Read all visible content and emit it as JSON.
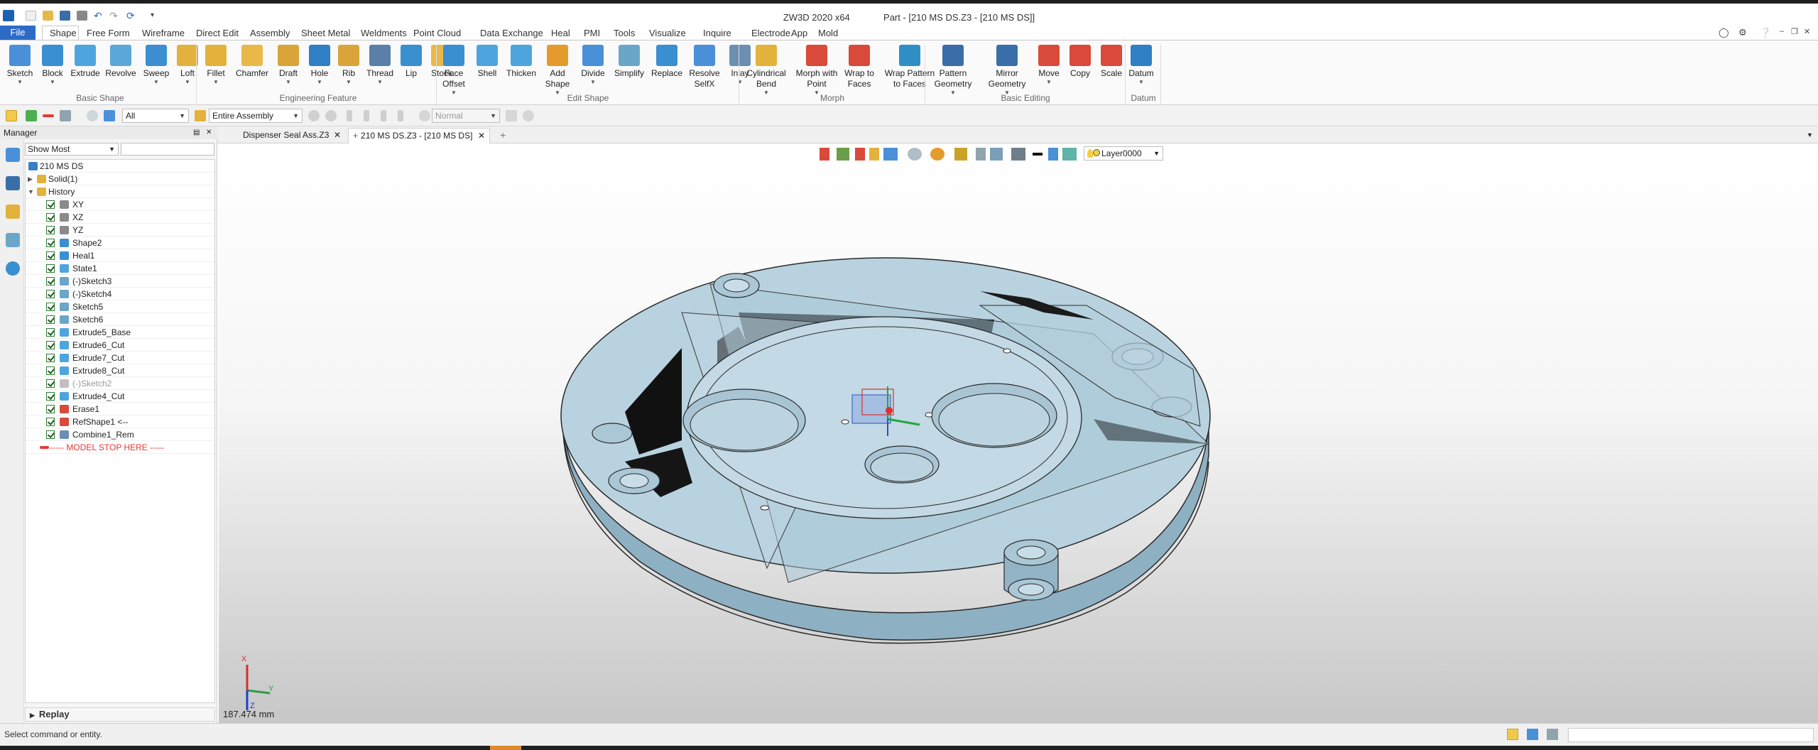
{
  "titlebar": {
    "app_title": "ZW3D 2020 x64",
    "doc_title": "Part - [210 MS DS.Z3 - [210 MS DS]]",
    "quick_access_icons": [
      "new-icon",
      "open-icon",
      "save-icon",
      "print-icon",
      "undo-icon",
      "redo-icon",
      "regen-icon",
      "customize-icon"
    ]
  },
  "menu": {
    "file": "File",
    "items": [
      "Shape",
      "Free Form",
      "Wireframe",
      "Direct Edit",
      "Assembly",
      "Sheet Metal",
      "Weldments",
      "Point Cloud",
      "Data Exchange",
      "Heal",
      "PMI",
      "Tools",
      "Visualize",
      "Inquire",
      "Electrode",
      "App",
      "Mold"
    ],
    "active": "Shape"
  },
  "ribbon": {
    "groups": [
      {
        "label": "Basic Shape",
        "buttons": [
          {
            "label": "Sketch",
            "color": "#4a90d9",
            "dropdown": true
          },
          {
            "label": "Block",
            "color": "#3a8fd0",
            "dropdown": true
          },
          {
            "label": "Extrude",
            "color": "#4ea5de",
            "dropdown": false
          },
          {
            "label": "Revolve",
            "color": "#5aa7d8",
            "dropdown": false
          },
          {
            "label": "Sweep",
            "color": "#3d8ed0",
            "dropdown": true
          },
          {
            "label": "Loft",
            "color": "#e3b23c",
            "dropdown": true
          }
        ]
      },
      {
        "label": "Engineering Feature",
        "buttons": [
          {
            "label": "Fillet",
            "color": "#e3b23c",
            "dropdown": true
          },
          {
            "label": "Chamfer",
            "color": "#e8b84a",
            "dropdown": false
          },
          {
            "label": "Draft",
            "color": "#d9a53a",
            "dropdown": true
          },
          {
            "label": "Hole",
            "color": "#2f7fc4",
            "dropdown": true
          },
          {
            "label": "Rib",
            "color": "#d9a53a",
            "dropdown": true
          },
          {
            "label": "Thread",
            "color": "#5a7fa8",
            "dropdown": true
          },
          {
            "label": "Lip",
            "color": "#3a8fd0",
            "dropdown": false
          },
          {
            "label": "Stock",
            "color": "#e8b84a",
            "dropdown": false
          }
        ]
      },
      {
        "label": "Edit Shape",
        "buttons": [
          {
            "label": "Face",
            "label2": "Offset",
            "color": "#3a8fd0",
            "dropdown": true
          },
          {
            "label": "Shell",
            "color": "#4ea5de",
            "dropdown": false
          },
          {
            "label": "Thicken",
            "color": "#4ea5de",
            "dropdown": false
          },
          {
            "label": "Add",
            "label2": "Shape",
            "color": "#e39b2c",
            "dropdown": true
          },
          {
            "label": "Divide",
            "color": "#4a90d9",
            "dropdown": true
          },
          {
            "label": "Simplify",
            "color": "#6aa6c8",
            "dropdown": false
          },
          {
            "label": "Replace",
            "color": "#3a8fd0",
            "dropdown": false
          },
          {
            "label": "Resolve",
            "label2": "SelfX",
            "color": "#4a90d9",
            "dropdown": false
          },
          {
            "label": "Inlay",
            "color": "#6a8fb0",
            "dropdown": true
          }
        ]
      },
      {
        "label": "Morph",
        "buttons": [
          {
            "label": "Cylindrical",
            "label2": "Bend",
            "color": "#e3b23c",
            "dropdown": true
          },
          {
            "label": "Morph with",
            "label2": "Point",
            "color": "#d94a3a",
            "dropdown": true
          },
          {
            "label": "Wrap to",
            "label2": "Faces",
            "color": "#d94a3a",
            "dropdown": false
          },
          {
            "label": "Wrap Pattern",
            "label2": "to Faces",
            "color": "#2f8fc4",
            "dropdown": false
          }
        ]
      },
      {
        "label": "Basic Editing",
        "buttons": [
          {
            "label": "Pattern",
            "label2": "Geometry",
            "color": "#3a6ea8",
            "dropdown": true
          },
          {
            "label": "Mirror",
            "label2": "Geometry",
            "color": "#3a6ea8",
            "dropdown": true
          },
          {
            "label": "Move",
            "color": "#d94a3a",
            "dropdown": true
          },
          {
            "label": "Copy",
            "color": "#d94a3a",
            "dropdown": false
          },
          {
            "label": "Scale",
            "color": "#d94a3a",
            "dropdown": false
          }
        ]
      },
      {
        "label": "Datum",
        "buttons": [
          {
            "label": "Datum",
            "color": "#2f7fc4",
            "dropdown": true
          }
        ]
      }
    ]
  },
  "toolbar2": {
    "filter_value": "All",
    "scope_value": "Entire Assembly",
    "mode_value": "Normal"
  },
  "manager": {
    "title": "Manager",
    "filter_value": "Show Most",
    "tree": [
      {
        "label": "210 MS DS",
        "level": 0,
        "checkbox": false,
        "icon_color": "#3a7fc4"
      },
      {
        "label": "Solid(1)",
        "level": 1,
        "checkbox": false,
        "expander": "+",
        "icon_color": "#e3b23c"
      },
      {
        "label": "History",
        "level": 1,
        "checkbox": false,
        "expander": "-",
        "icon_color": "#e3b23c"
      },
      {
        "label": "XY",
        "checkbox": true,
        "icon_color": "#8a8a8a"
      },
      {
        "label": "XZ",
        "checkbox": true,
        "icon_color": "#8a8a8a"
      },
      {
        "label": "YZ",
        "checkbox": true,
        "icon_color": "#8a8a8a"
      },
      {
        "label": "Shape2",
        "checkbox": true,
        "icon_color": "#3a8fd0"
      },
      {
        "label": "Heal1",
        "checkbox": true,
        "icon_color": "#3a8fd0"
      },
      {
        "label": "State1",
        "checkbox": true,
        "icon_color": "#4ea5de"
      },
      {
        "label": "(-)Sketch3",
        "checkbox": true,
        "icon_color": "#6aa6c8"
      },
      {
        "label": "(-)Sketch4",
        "checkbox": true,
        "icon_color": "#6aa6c8"
      },
      {
        "label": "Sketch5",
        "checkbox": true,
        "icon_color": "#6aa6c8"
      },
      {
        "label": "Sketch6",
        "checkbox": true,
        "icon_color": "#6aa6c8"
      },
      {
        "label": "Extrude5_Base",
        "checkbox": true,
        "icon_color": "#4ea5de"
      },
      {
        "label": "Extrude6_Cut",
        "checkbox": true,
        "icon_color": "#4ea5de"
      },
      {
        "label": "Extrude7_Cut",
        "checkbox": true,
        "icon_color": "#4ea5de"
      },
      {
        "label": "Extrude8_Cut",
        "checkbox": true,
        "icon_color": "#4ea5de"
      },
      {
        "label": "(-)Sketch2",
        "checkbox": true,
        "icon_color": "#c0c0c0",
        "muted": true
      },
      {
        "label": "Extrude4_Cut",
        "checkbox": true,
        "icon_color": "#4ea5de"
      },
      {
        "label": "Erase1",
        "checkbox": true,
        "icon_color": "#d94a3a"
      },
      {
        "label": "RefShape1 <--",
        "checkbox": true,
        "icon_color": "#d94a3a"
      },
      {
        "label": "Combine1_Rem",
        "checkbox": true,
        "icon_color": "#6a8fb0"
      },
      {
        "label": "----- MODEL STOP HERE -----",
        "checkbox": false,
        "stop": true,
        "icon_color": "#e53935"
      }
    ],
    "replay_label": "Replay"
  },
  "doc_tabs": [
    {
      "label": "Dispenser Seal Ass.Z3",
      "active": false
    },
    {
      "label": "210 MS DS.Z3 - [210 MS DS]",
      "active": true
    }
  ],
  "viewport": {
    "layer": "Layer0000",
    "scale_readout": "187.474 mm",
    "triad_axes": [
      "X",
      "Y",
      "Z"
    ]
  },
  "status": {
    "prompt": "Select command or entity."
  },
  "colors": {
    "accent": "#2e6bc7",
    "part": "#a9c5d4",
    "part_dark": "#7fa3b7"
  }
}
